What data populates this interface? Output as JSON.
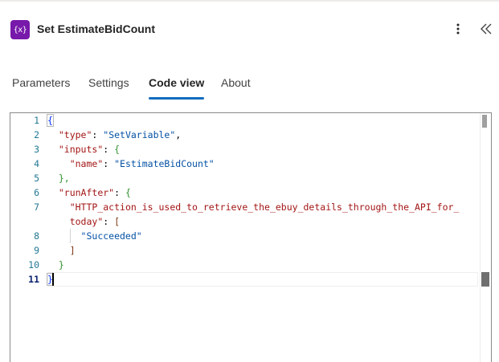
{
  "header": {
    "icon_text": "{x}",
    "title": "Set EstimateBidCount"
  },
  "tabs": [
    {
      "label": "Parameters",
      "active": false
    },
    {
      "label": "Settings",
      "active": false
    },
    {
      "label": "Code view",
      "active": true
    },
    {
      "label": "About",
      "active": false
    }
  ],
  "editor": {
    "line_numbers": [
      "1",
      "2",
      "3",
      "4",
      "5",
      "6",
      "7",
      "",
      "8",
      "9",
      "10",
      "11"
    ],
    "current_line": "11",
    "tokens": {
      "open_brace": "{",
      "close_brace": "}",
      "close_brace_comma": "},",
      "open_bracket": "[",
      "close_bracket": "]",
      "colon": ": ",
      "comma": ",",
      "key_type": "\"type\"",
      "val_type": "\"SetVariable\"",
      "key_inputs": "\"inputs\"",
      "key_name": "\"name\"",
      "val_name": "\"EstimateBidCount\"",
      "key_runafter": "\"runAfter\"",
      "key_http_part1": "\"HTTP_action_is_used_to_retrieve_the_ebuy_details_through_the_API_for_",
      "key_http_part2": "today\"",
      "val_succeeded": "\"Succeeded\""
    }
  },
  "colors": {
    "accent": "#0f6cbd",
    "action_icon_bg": "#7719aa",
    "json_key": "#a31515",
    "json_string": "#0451a5"
  },
  "icons": {
    "action": "variable-icon",
    "more": "more-vertical-icon",
    "collapse": "double-chevron-left-icon"
  }
}
